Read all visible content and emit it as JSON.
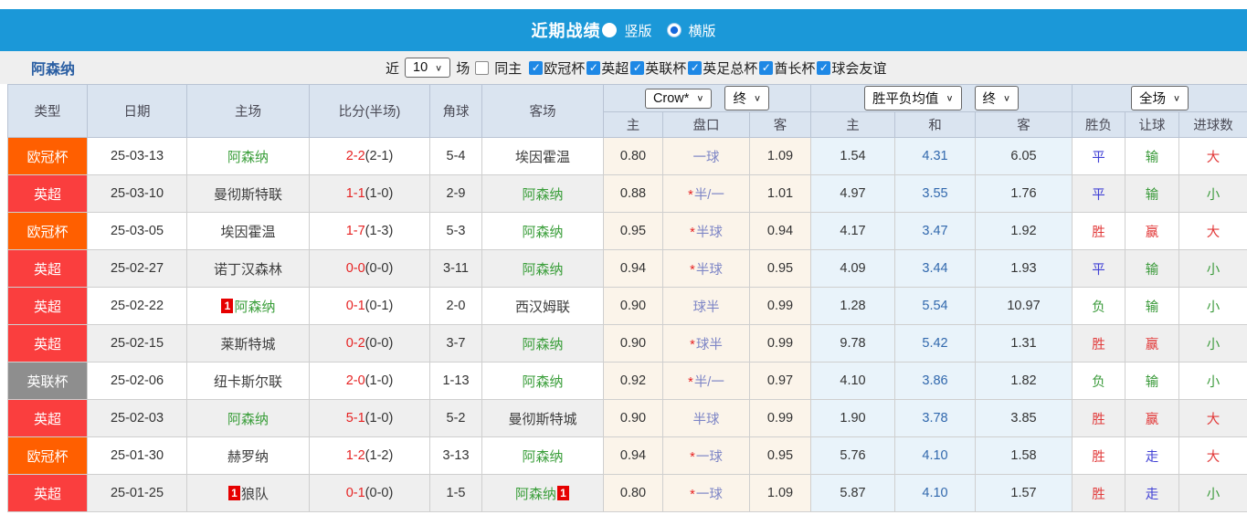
{
  "title_bar": {
    "title": "近期战绩",
    "radios": [
      {
        "label": "竖版",
        "checked": false
      },
      {
        "label": "横版",
        "checked": true
      }
    ]
  },
  "filter_bar": {
    "team": "阿森纳",
    "recent_label": "近",
    "count_value": "10",
    "games_label": "场",
    "same_home": {
      "label": "同主",
      "checked": false
    },
    "competitions": [
      {
        "label": "欧冠杯",
        "checked": true
      },
      {
        "label": "英超",
        "checked": true
      },
      {
        "label": "英联杯",
        "checked": true
      },
      {
        "label": "英足总杯",
        "checked": true
      },
      {
        "label": "酋长杯",
        "checked": true
      },
      {
        "label": "球会友谊",
        "checked": true
      }
    ]
  },
  "icons": {
    "chevron_down": "∨",
    "check": "✓"
  },
  "colors": {
    "title_bar_blue": "#1b98d8",
    "result_red": "#e23a3a",
    "result_blue": "#4141d5",
    "result_green": "#3a9a3a"
  },
  "table": {
    "header": {
      "type": "类型",
      "date": "日期",
      "home": "主场",
      "score": "比分(半场)",
      "corner": "角球",
      "away": "客场",
      "sub": {
        "odds_home": "主",
        "odds_handicap": "盘口",
        "odds_away": "客",
        "mean_home": "主",
        "mean_draw": "和",
        "mean_away": "客",
        "result_outcome": "胜负",
        "result_handicap": "让球",
        "result_goals": "进球数"
      }
    },
    "selectors": {
      "odds_company": "Crow*",
      "odds_time": "终",
      "mean_type": "胜平负均值",
      "mean_time": "终",
      "scope": "全场"
    },
    "rows": [
      {
        "type": {
          "label": "欧冠杯",
          "color": "#ff5f00"
        },
        "date": "25-03-13",
        "home": {
          "name": "阿森纳",
          "is_focus": true
        },
        "score": {
          "full": "2-2",
          "half": "(2-1)"
        },
        "corner": "5-4",
        "away": {
          "name": "埃因霍温",
          "is_focus": false
        },
        "odds": {
          "home": "0.80",
          "star": false,
          "handicap": "一球",
          "away": "1.09"
        },
        "mean": {
          "win": "1.54",
          "draw": "4.31",
          "lose": "6.05"
        },
        "results": {
          "outcome": {
            "text": "平",
            "tone": "blue"
          },
          "handicap": {
            "text": "输",
            "tone": "green"
          },
          "goals": {
            "text": "大",
            "tone": "red"
          }
        }
      },
      {
        "type": {
          "label": "英超",
          "color": "#fa3e3e"
        },
        "date": "25-03-10",
        "home": {
          "name": "曼彻斯特联",
          "is_focus": false
        },
        "score": {
          "full": "1-1",
          "half": "(1-0)"
        },
        "corner": "2-9",
        "away": {
          "name": "阿森纳",
          "is_focus": true
        },
        "odds": {
          "home": "0.88",
          "star": true,
          "handicap": "半/一",
          "away": "1.01"
        },
        "mean": {
          "win": "4.97",
          "draw": "3.55",
          "lose": "1.76"
        },
        "results": {
          "outcome": {
            "text": "平",
            "tone": "blue"
          },
          "handicap": {
            "text": "输",
            "tone": "green"
          },
          "goals": {
            "text": "小",
            "tone": "green"
          }
        }
      },
      {
        "type": {
          "label": "欧冠杯",
          "color": "#ff5f00"
        },
        "date": "25-03-05",
        "home": {
          "name": "埃因霍温",
          "is_focus": false
        },
        "score": {
          "full": "1-7",
          "half": "(1-3)"
        },
        "corner": "5-3",
        "away": {
          "name": "阿森纳",
          "is_focus": true
        },
        "odds": {
          "home": "0.95",
          "star": true,
          "handicap": "半球",
          "away": "0.94"
        },
        "mean": {
          "win": "4.17",
          "draw": "3.47",
          "lose": "1.92"
        },
        "results": {
          "outcome": {
            "text": "胜",
            "tone": "red"
          },
          "handicap": {
            "text": "赢",
            "tone": "red"
          },
          "goals": {
            "text": "大",
            "tone": "red"
          }
        }
      },
      {
        "type": {
          "label": "英超",
          "color": "#fa3e3e"
        },
        "date": "25-02-27",
        "home": {
          "name": "诺丁汉森林",
          "is_focus": false
        },
        "score": {
          "full": "0-0",
          "half": "(0-0)"
        },
        "corner": "3-11",
        "away": {
          "name": "阿森纳",
          "is_focus": true
        },
        "odds": {
          "home": "0.94",
          "star": true,
          "handicap": "半球",
          "away": "0.95"
        },
        "mean": {
          "win": "4.09",
          "draw": "3.44",
          "lose": "1.93"
        },
        "results": {
          "outcome": {
            "text": "平",
            "tone": "blue"
          },
          "handicap": {
            "text": "输",
            "tone": "green"
          },
          "goals": {
            "text": "小",
            "tone": "green"
          }
        }
      },
      {
        "type": {
          "label": "英超",
          "color": "#fa3e3e"
        },
        "date": "25-02-22",
        "home": {
          "name": "阿森纳",
          "is_focus": true,
          "badge_before": "1"
        },
        "score": {
          "full": "0-1",
          "half": "(0-1)"
        },
        "corner": "2-0",
        "away": {
          "name": "西汉姆联",
          "is_focus": false
        },
        "odds": {
          "home": "0.90",
          "star": false,
          "handicap": "球半",
          "away": "0.99"
        },
        "mean": {
          "win": "1.28",
          "draw": "5.54",
          "lose": "10.97"
        },
        "results": {
          "outcome": {
            "text": "负",
            "tone": "green"
          },
          "handicap": {
            "text": "输",
            "tone": "green"
          },
          "goals": {
            "text": "小",
            "tone": "green"
          }
        }
      },
      {
        "type": {
          "label": "英超",
          "color": "#fa3e3e"
        },
        "date": "25-02-15",
        "home": {
          "name": "莱斯特城",
          "is_focus": false
        },
        "score": {
          "full": "0-2",
          "half": "(0-0)"
        },
        "corner": "3-7",
        "away": {
          "name": "阿森纳",
          "is_focus": true
        },
        "odds": {
          "home": "0.90",
          "star": true,
          "handicap": "球半",
          "away": "0.99"
        },
        "mean": {
          "win": "9.78",
          "draw": "5.42",
          "lose": "1.31"
        },
        "results": {
          "outcome": {
            "text": "胜",
            "tone": "red"
          },
          "handicap": {
            "text": "赢",
            "tone": "red"
          },
          "goals": {
            "text": "小",
            "tone": "green"
          }
        }
      },
      {
        "type": {
          "label": "英联杯",
          "color": "#8e8e8e"
        },
        "date": "25-02-06",
        "home": {
          "name": "纽卡斯尔联",
          "is_focus": false
        },
        "score": {
          "full": "2-0",
          "half": "(1-0)"
        },
        "corner": "1-13",
        "away": {
          "name": "阿森纳",
          "is_focus": true
        },
        "odds": {
          "home": "0.92",
          "star": true,
          "handicap": "半/一",
          "away": "0.97"
        },
        "mean": {
          "win": "4.10",
          "draw": "3.86",
          "lose": "1.82"
        },
        "results": {
          "outcome": {
            "text": "负",
            "tone": "green"
          },
          "handicap": {
            "text": "输",
            "tone": "green"
          },
          "goals": {
            "text": "小",
            "tone": "green"
          }
        }
      },
      {
        "type": {
          "label": "英超",
          "color": "#fa3e3e"
        },
        "date": "25-02-03",
        "home": {
          "name": "阿森纳",
          "is_focus": true
        },
        "score": {
          "full": "5-1",
          "half": "(1-0)"
        },
        "corner": "5-2",
        "away": {
          "name": "曼彻斯特城",
          "is_focus": false
        },
        "odds": {
          "home": "0.90",
          "star": false,
          "handicap": "半球",
          "away": "0.99"
        },
        "mean": {
          "win": "1.90",
          "draw": "3.78",
          "lose": "3.85"
        },
        "results": {
          "outcome": {
            "text": "胜",
            "tone": "red"
          },
          "handicap": {
            "text": "赢",
            "tone": "red"
          },
          "goals": {
            "text": "大",
            "tone": "red"
          }
        }
      },
      {
        "type": {
          "label": "欧冠杯",
          "color": "#ff5f00"
        },
        "date": "25-01-30",
        "home": {
          "name": "赫罗纳",
          "is_focus": false
        },
        "score": {
          "full": "1-2",
          "half": "(1-2)"
        },
        "corner": "3-13",
        "away": {
          "name": "阿森纳",
          "is_focus": true
        },
        "odds": {
          "home": "0.94",
          "star": true,
          "handicap": "一球",
          "away": "0.95"
        },
        "mean": {
          "win": "5.76",
          "draw": "4.10",
          "lose": "1.58"
        },
        "results": {
          "outcome": {
            "text": "胜",
            "tone": "red"
          },
          "handicap": {
            "text": "走",
            "tone": "blue"
          },
          "goals": {
            "text": "大",
            "tone": "red"
          }
        }
      },
      {
        "type": {
          "label": "英超",
          "color": "#fa3e3e"
        },
        "date": "25-01-25",
        "home": {
          "name": "狼队",
          "is_focus": false,
          "badge_before": "1"
        },
        "score": {
          "full": "0-1",
          "half": "(0-0)"
        },
        "corner": "1-5",
        "away": {
          "name": "阿森纳",
          "is_focus": true,
          "badge_after": "1"
        },
        "odds": {
          "home": "0.80",
          "star": true,
          "handicap": "一球",
          "away": "1.09"
        },
        "mean": {
          "win": "5.87",
          "draw": "4.10",
          "lose": "1.57"
        },
        "results": {
          "outcome": {
            "text": "胜",
            "tone": "red"
          },
          "handicap": {
            "text": "走",
            "tone": "blue"
          },
          "goals": {
            "text": "小",
            "tone": "green"
          }
        }
      }
    ]
  }
}
